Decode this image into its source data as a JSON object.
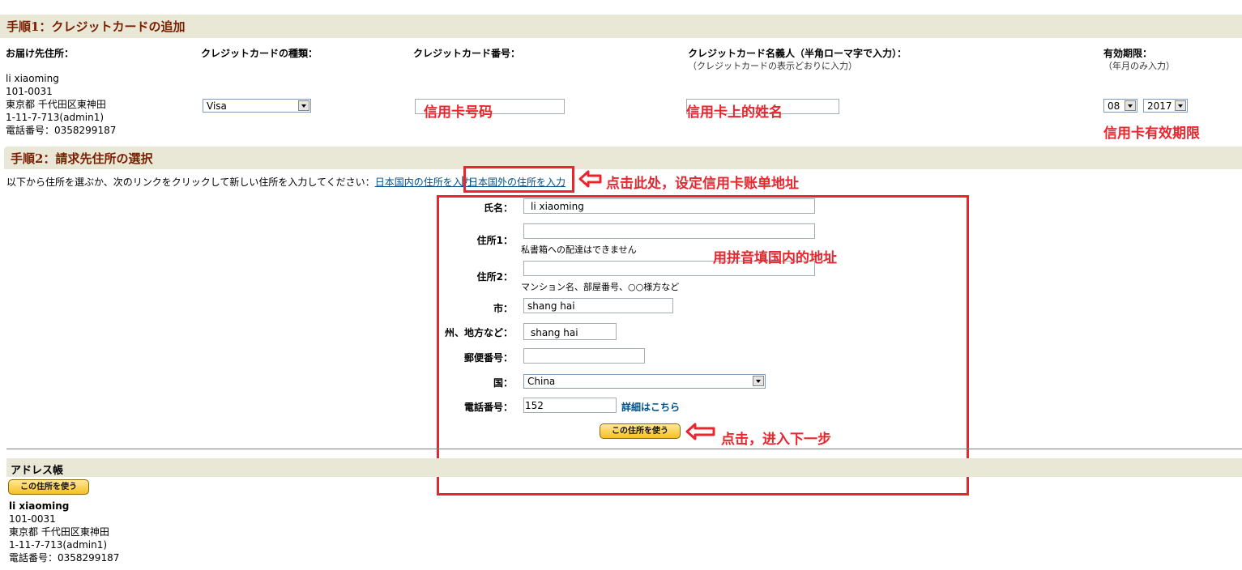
{
  "step1": {
    "title": "手順1：クレジットカードの追加",
    "col_address": "お届け先住所：",
    "col_card_type": "クレジットカードの種類：",
    "col_card_number": "クレジットカード番号：",
    "col_card_name": "クレジットカード名義人（半角ローマ字で入力）：",
    "col_card_name_note": "（クレジットカードの表示どおりに入力）",
    "col_expiry": "有効期限：",
    "col_expiry_note": "（年月のみ入力）",
    "address_lines": [
      "li xiaoming",
      "101-0031",
      "東京都 千代田区東神田",
      "1-11-7-713(admin1)",
      "電話番号：0358299187"
    ],
    "card_type_value": "Visa",
    "expiry_month": "08",
    "expiry_year": "2017",
    "annot_card_number": "信用卡号码",
    "annot_card_name": "信用卡上的姓名",
    "annot_expiry": "信用卡有效期限"
  },
  "step2": {
    "title": "手順2：請求先住所の選択",
    "instruction": "以下から住所を選ぶか、次のリンクをクリックして新しい住所を入力してください：",
    "link_domestic": "日本国内の住所を入力",
    "separator": "|",
    "link_overseas": "日本国外の住所を入力",
    "annot_click_here": "点击此处，设定信用卡账单地址",
    "annot_pinyin": "用拼音填国内的地址",
    "annot_next": "点击，进入下一步",
    "form": {
      "name_label": "氏名：",
      "name_value": "li xiaoming",
      "addr1_label": "住所1：",
      "addr1_hint": "私書箱への配達はできません",
      "addr2_label": "住所2：",
      "addr2_hint": "マンション名、部屋番号、○○様方など",
      "city_label": "市：",
      "city_value": "shang hai",
      "state_label": "州、地方など：",
      "state_value": "shang hai",
      "zip_label": "郵便番号：",
      "country_label": "国：",
      "country_value": "China",
      "phone_label": "電話番号：",
      "phone_value": "152",
      "phone_detail_link": "詳細はこちら",
      "use_address_button": "この住所を使う"
    }
  },
  "address_book": {
    "title": "アドレス帳",
    "use_button": "この住所を使う",
    "name": "li xiaoming",
    "lines": [
      "101-0031",
      "東京都 千代田区東神田",
      "1-11-7-713(admin1)",
      "電話番号：0358299187"
    ]
  }
}
